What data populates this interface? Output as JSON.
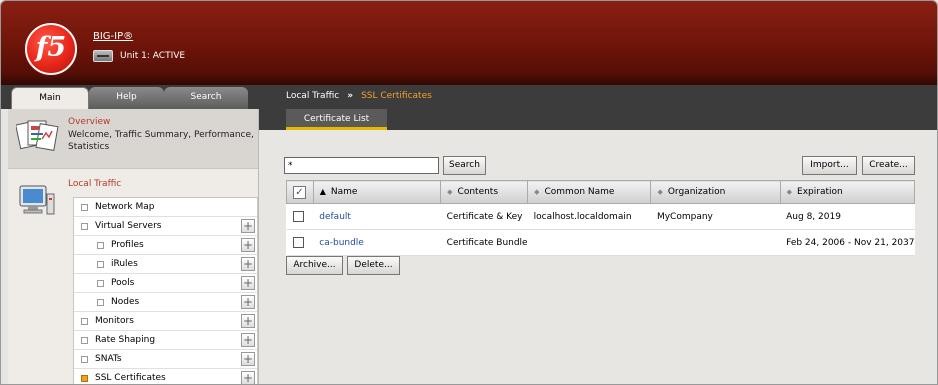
{
  "banner": {
    "logo_text": "f5",
    "product": "BIG-IP®",
    "unit_status": "Unit 1: ACTIVE"
  },
  "tabs": [
    {
      "label": "Main",
      "active": true
    },
    {
      "label": "Help",
      "active": false
    },
    {
      "label": "Search",
      "active": false
    }
  ],
  "breadcrumb": {
    "section": "Local Traffic",
    "separator": "»",
    "current": "SSL Certificates"
  },
  "sidebar": {
    "overview": {
      "title": "Overview",
      "links": "Welcome, Traffic Summary, Performance, Statistics"
    },
    "local_traffic": {
      "title": "Local Traffic",
      "items": [
        {
          "label": "Network Map",
          "indent": 0,
          "plus": false,
          "selected": false
        },
        {
          "label": "Virtual Servers",
          "indent": 0,
          "plus": true,
          "selected": false
        },
        {
          "label": "Profiles",
          "indent": 1,
          "plus": true,
          "selected": false
        },
        {
          "label": "iRules",
          "indent": 1,
          "plus": true,
          "selected": false
        },
        {
          "label": "Pools",
          "indent": 1,
          "plus": true,
          "selected": false
        },
        {
          "label": "Nodes",
          "indent": 1,
          "plus": true,
          "selected": false
        },
        {
          "label": "Monitors",
          "indent": 0,
          "plus": true,
          "selected": false
        },
        {
          "label": "Rate Shaping",
          "indent": 0,
          "plus": true,
          "selected": false
        },
        {
          "label": "SNATs",
          "indent": 0,
          "plus": true,
          "selected": false
        },
        {
          "label": "SSL Certificates",
          "indent": 0,
          "plus": true,
          "selected": true
        }
      ]
    }
  },
  "main": {
    "subtab": "Certificate List",
    "search": {
      "value": "*",
      "button": "Search"
    },
    "import_label": "Import...",
    "create_label": "Create...",
    "archive_label": "Archive...",
    "delete_label": "Delete...",
    "columns": [
      "Name",
      "Contents",
      "Common Name",
      "Organization",
      "Expiration"
    ],
    "rows": [
      {
        "name": "default",
        "contents": "Certificate & Key",
        "common_name": "localhost.localdomain",
        "organization": "MyCompany",
        "expiration": "Aug 8, 2019"
      },
      {
        "name": "ca-bundle",
        "contents": "Certificate Bundle",
        "common_name": "",
        "organization": "",
        "expiration": "Feb 24, 2006 - Nov 21, 2037"
      }
    ]
  },
  "colors": {
    "banner": "#7a1a0e",
    "section_title": "#b23a2a",
    "breadcrumb_current": "#f2a12a",
    "link": "#1f4fa0",
    "subtab_underline": "#e6b800"
  }
}
